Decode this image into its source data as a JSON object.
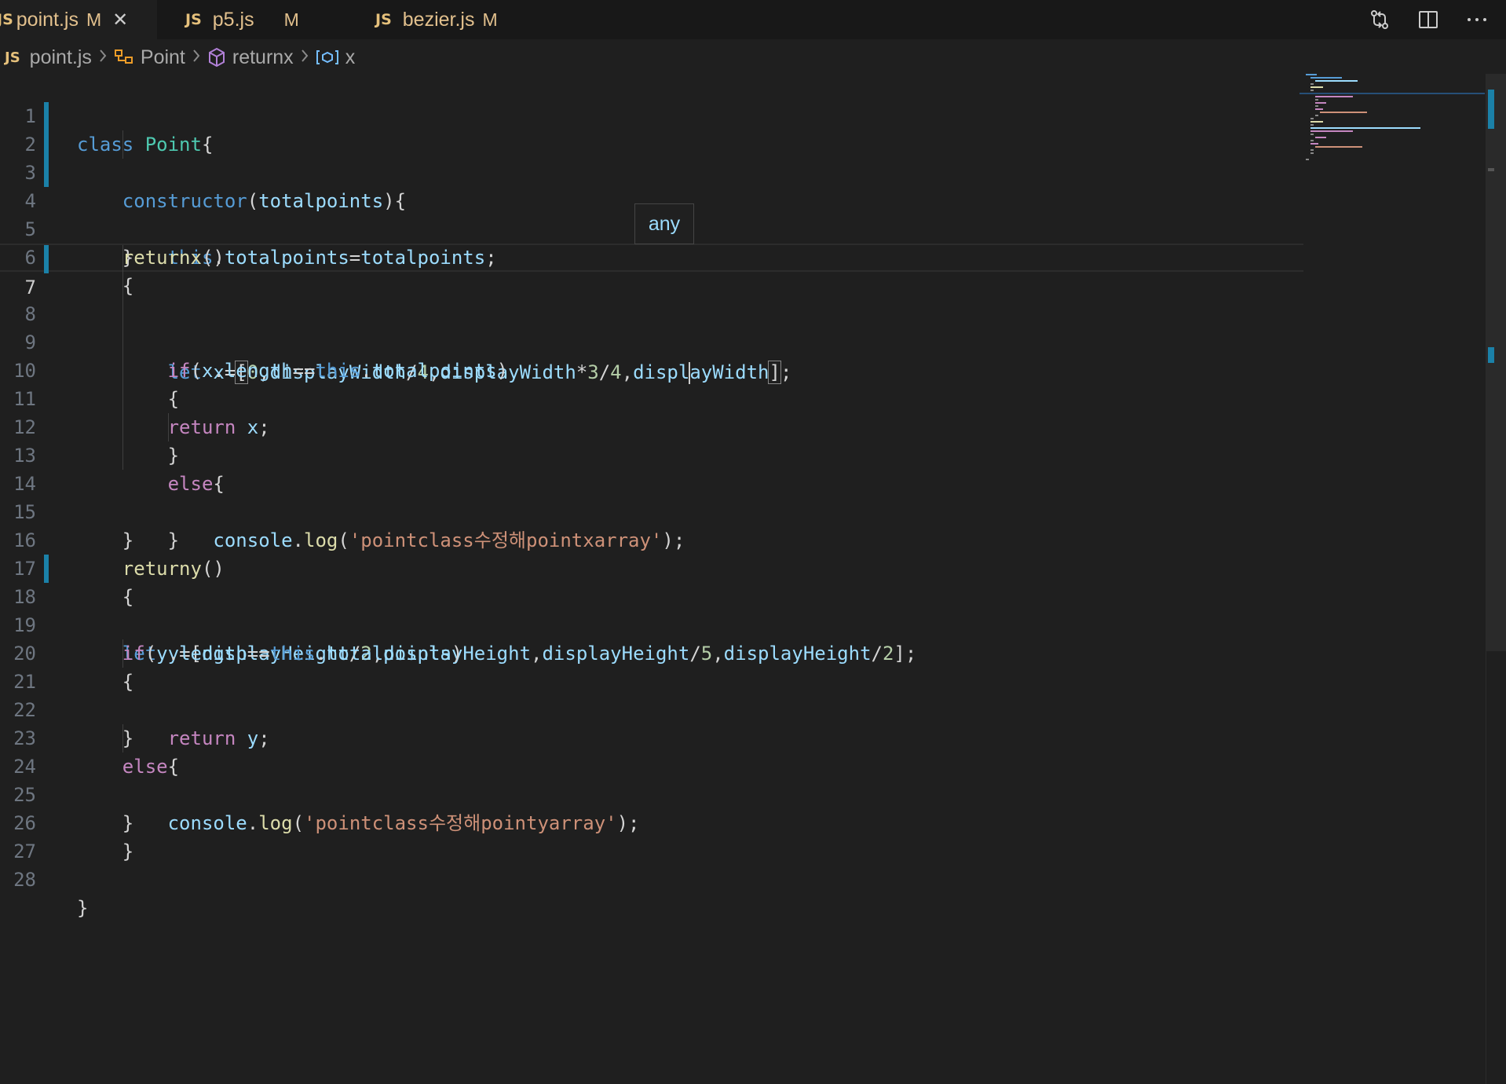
{
  "tabs": [
    {
      "label": "point.js",
      "badge": "JS",
      "modified": "M",
      "close": "✕"
    },
    {
      "label": "p5.js",
      "badge": "JS",
      "modified": "M"
    },
    {
      "label": "bezier.js",
      "badge": "JS",
      "modified": "M"
    }
  ],
  "breadcrumb": {
    "file": "point.js",
    "file_badge": "JS",
    "class_name": "Point",
    "method_name": "returnx",
    "variable_name": "x"
  },
  "hover": {
    "text": "any"
  },
  "line_numbers": [
    "1",
    "2",
    "3",
    "4",
    "5",
    "6",
    "7",
    "8",
    "9",
    "10",
    "11",
    "12",
    "13",
    "14",
    "15",
    "16",
    "17",
    "18",
    "19",
    "20",
    "21",
    "22",
    "23",
    "24",
    "25",
    "26",
    "27",
    "28"
  ],
  "code": {
    "l1_class": "class",
    "l1_name": "Point",
    "l1_brace": "{",
    "l2_ctor": "constructor",
    "l2_open": "(",
    "l2_param": "totalpoints",
    "l2_close": "){",
    "l3_this": "this",
    "l3_dot": ".",
    "l3_prop": "totalpoints",
    "l3_eq": "=",
    "l3_val": "totalpoints",
    "l3_semi": ";",
    "l4": "}",
    "l5_fn": "returnx",
    "l5_paren": "()",
    "l6": "{",
    "l7_let": "let",
    "l7_x": "x",
    "l7_eq": "=",
    "l7_lb": "[",
    "l7_zero": "0",
    "l7_c1": ",",
    "l7_dw1": "displayWidth",
    "l7_div1": "/",
    "l7_four1": "4",
    "l7_c2": ",",
    "l7_dw2": "displayWidth",
    "l7_mul": "*",
    "l7_three": "3",
    "l7_div2": "/",
    "l7_four2": "4",
    "l7_c3": ",",
    "l7_dw3a": "displ",
    "l7_dw3b": "ayWidth",
    "l7_rb": "]",
    "l7_semi": ";",
    "l8_if": "if",
    "l8_open": "(",
    "l8_x": "x",
    "l8_dot": ".",
    "l8_len": "length",
    "l8_eq": "==",
    "l8_this": "this",
    "l8_dot2": ".",
    "l8_tp": "totalpoints",
    "l8_close": ")",
    "l9": "{",
    "l10_ret": "return",
    "l10_x": "x",
    "l10_semi": ";",
    "l11": "}",
    "l12_else": "else",
    "l12_brace": "{",
    "l13_console": "console",
    "l13_dot": ".",
    "l13_log": "log",
    "l13_open": "(",
    "l13_str": "'pointclass수정해pointxarray'",
    "l13_close": ");",
    "l14": "}",
    "l15": "}",
    "l16_fn": "returny",
    "l16_paren": "()",
    "l17": "{",
    "l18_let": "let",
    "l18_y": "y",
    "l18_eq": "=",
    "l18_lb": "[",
    "l18_dh1": "displayHeight",
    "l18_div1": "/",
    "l18_two1": "2",
    "l18_c1": ",",
    "l18_dh2": "displayHeight",
    "l18_c2": ",",
    "l18_dh3": "displayHeight",
    "l18_div2": "/",
    "l18_five": "5",
    "l18_c3": ",",
    "l18_dh4": "displayHeight",
    "l18_div3": "/",
    "l18_two2": "2",
    "l18_rb": "];",
    "l19_if": "if",
    "l19_open": "(",
    "l19_y": "y",
    "l19_dot": ".",
    "l19_len": "length",
    "l19_eq": "==",
    "l19_this": "this",
    "l19_dot2": ".",
    "l19_tp": "totalpoints",
    "l19_close": ")",
    "l20": "{",
    "l21_ret": "return",
    "l21_y": "y",
    "l21_semi": ";",
    "l22": "}",
    "l23_else": "else",
    "l23_brace": "{",
    "l24_console": "console",
    "l24_dot": ".",
    "l24_log": "log",
    "l24_open": "(",
    "l24_str": "'pointclass수정해pointyarray'",
    "l24_close": ");",
    "l25": "}",
    "l26": "}",
    "l28": "}"
  },
  "colors": {
    "background": "#1f1f1f",
    "keyword_blue": "#569cd6",
    "keyword_purple": "#c586c0",
    "class_teal": "#4ec9b0",
    "function_yellow": "#dcdcaa",
    "variable": "#9cdcfe",
    "number": "#b5cea8",
    "string": "#ce9178",
    "modified_marker": "#1b81a8"
  },
  "icons": [
    "js-file-icon",
    "close-icon",
    "compare-changes-icon",
    "split-editor-icon",
    "more-actions-icon",
    "chevron-right-icon",
    "class-icon",
    "method-icon",
    "variable-icon"
  ]
}
